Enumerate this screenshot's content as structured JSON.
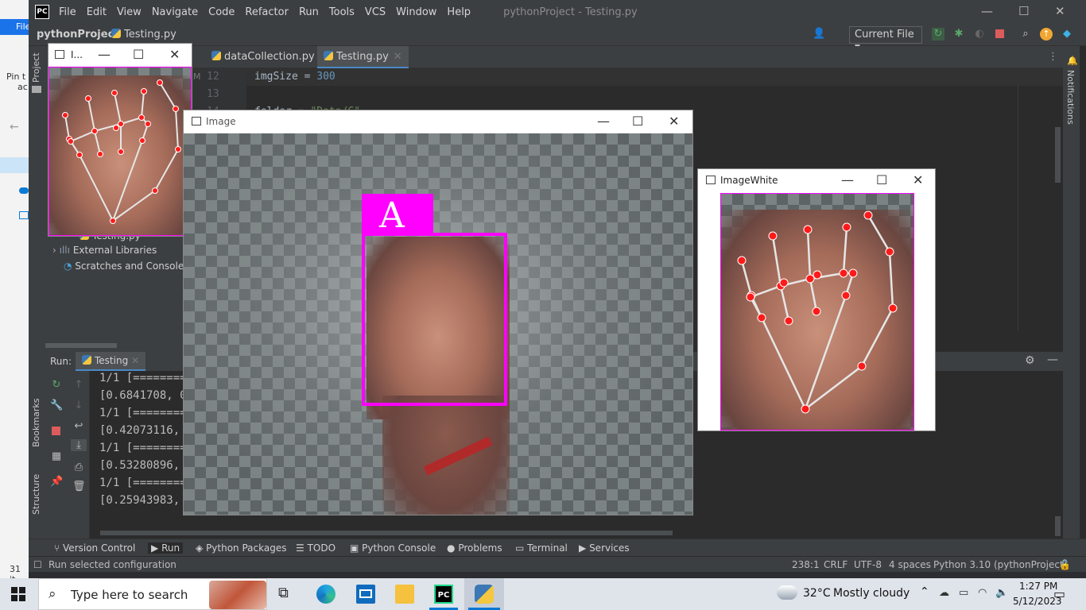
{
  "background_app": {
    "menu_label": "File",
    "pin_text_1": "Pin t",
    "pin_text_2": "ac",
    "items_count": "31 it"
  },
  "ide": {
    "menu": [
      "File",
      "Edit",
      "View",
      "Navigate",
      "Code",
      "Refactor",
      "Run",
      "Tools",
      "VCS",
      "Window",
      "Help"
    ],
    "window_title": "pythonProject - Testing.py",
    "logo_text": "PC",
    "breadcrumb": {
      "project": "pythonProject",
      "file": "Testing.py"
    },
    "run_config": "Current File",
    "tabs": [
      {
        "label": "dataCollection.py",
        "active": false
      },
      {
        "label": "Testing.py",
        "active": true
      }
    ],
    "editor": {
      "lines": [
        {
          "number": "12",
          "code_var": "imgSize",
          "code_op": " = ",
          "code_val": "300"
        },
        {
          "number": "13",
          "code_var": "",
          "code_op": "",
          "code_val": ""
        },
        {
          "number": "14",
          "code_var": "folder",
          "code_op": " = ",
          "code_val": "\"Data/C\""
        }
      ]
    },
    "left_strip": {
      "project": "Project",
      "bookmarks": "Bookmarks",
      "structure": "Structure"
    },
    "right_strip": {
      "notifications": "Notifications"
    },
    "project_tree": [
      {
        "label": "Testing.py"
      },
      {
        "label": "External Libraries"
      },
      {
        "label": "Scratches and Consoles"
      }
    ],
    "run_panel": {
      "label": "Run:",
      "tab": "Testing",
      "output": [
        "1/1 [========",
        "[0.6841708, 0",
        "1/1 [========",
        "[0.42073116, ",
        "1/1 [========",
        "[0.53280896, ",
        "1/1 [========",
        "[0.25943983, "
      ]
    },
    "tool_windows": [
      "Version Control",
      "Run",
      "Python Packages",
      "TODO",
      "Python Console",
      "Problems",
      "Terminal",
      "Services"
    ],
    "status": {
      "message": "Run selected configuration",
      "position": "238:1",
      "line_sep": "CRLF",
      "encoding": "UTF-8",
      "indent": "4 spaces",
      "interpreter": "Python 3.10 (pythonProject)"
    }
  },
  "windows": {
    "small": {
      "title": "I..."
    },
    "image": {
      "title": "Image",
      "prediction": "A"
    },
    "image_white": {
      "title": "ImageWhite"
    }
  },
  "taskbar": {
    "search_placeholder": "Type here to search",
    "weather_temp": "32°C",
    "weather_desc": "Mostly cloudy",
    "time": "1:27 PM",
    "date": "5/12/2023"
  },
  "colors": {
    "accent_magenta": "#ff00ff",
    "landmark_red": "#ff0000",
    "ide_bg": "#2b2b2b",
    "ide_panel": "#3c3f41"
  }
}
